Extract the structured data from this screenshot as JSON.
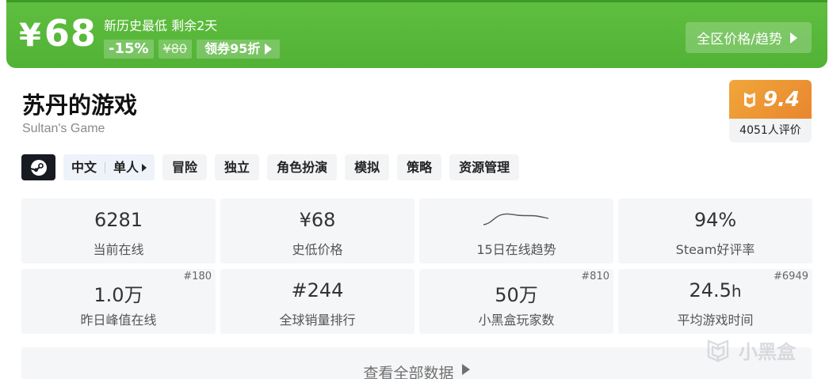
{
  "price": {
    "currency": "¥",
    "amount": "68"
  },
  "promo": {
    "title": "新历史最低 剩余2天",
    "discount": "-15%",
    "original": "¥80",
    "coupon": "领券95折"
  },
  "all_price_button": "全区价格/趋势",
  "game": {
    "title_cn": "苏丹的游戏",
    "title_en": "Sultan's Game"
  },
  "score": {
    "value": "9.4",
    "count": "4051人评价",
    "color": "#ec9a35"
  },
  "tags": {
    "lang": "中文",
    "mode": "单人",
    "items": [
      "冒险",
      "独立",
      "角色扮演",
      "模拟",
      "策略",
      "资源管理"
    ]
  },
  "stats": [
    {
      "value": "6281",
      "unit": "",
      "label": "当前在线",
      "rank": ""
    },
    {
      "value": "¥68",
      "unit": "",
      "label": "史低价格",
      "rank": ""
    },
    {
      "value": "",
      "unit": "",
      "label": "15日在线趋势",
      "rank": ""
    },
    {
      "value": "94%",
      "unit": "",
      "label": "Steam好评率",
      "rank": ""
    },
    {
      "value": "1.0万",
      "unit": "",
      "label": "昨日峰值在线",
      "rank": "#180"
    },
    {
      "value": "#244",
      "unit": "",
      "label": "全球销量排行",
      "rank": ""
    },
    {
      "value": "50万",
      "unit": "",
      "label": "小黑盒玩家数",
      "rank": "#810"
    },
    {
      "value": "24.5",
      "unit": "h",
      "label": "平均游戏时间",
      "rank": "#6949"
    }
  ],
  "view_all": "查看全部数据",
  "watermark": "小黑盒",
  "colors": {
    "banner": "#55b539",
    "steam": "#171a21"
  }
}
